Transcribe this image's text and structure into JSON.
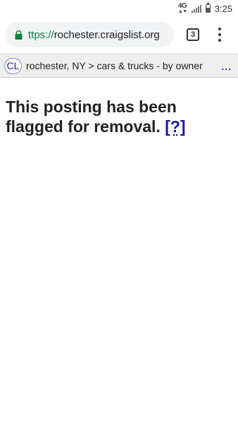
{
  "status_bar": {
    "network": "4G",
    "clock": "3:25",
    "battery_level": 0.6
  },
  "browser": {
    "url_scheme": "ttps://",
    "url_host": "rochester.craigslist.org",
    "tab_count": "3"
  },
  "header": {
    "logo": "CL",
    "breadcrumb": "rochester, NY > cars & trucks - by owner",
    "more": "..."
  },
  "message": {
    "text": "This posting has been flagged for removal.",
    "help_link": "[?]"
  },
  "colors": {
    "link": "#1a0dab",
    "url_scheme": "#0b8043",
    "lock": "#0b8043",
    "header_bg": "#eeeeee"
  }
}
